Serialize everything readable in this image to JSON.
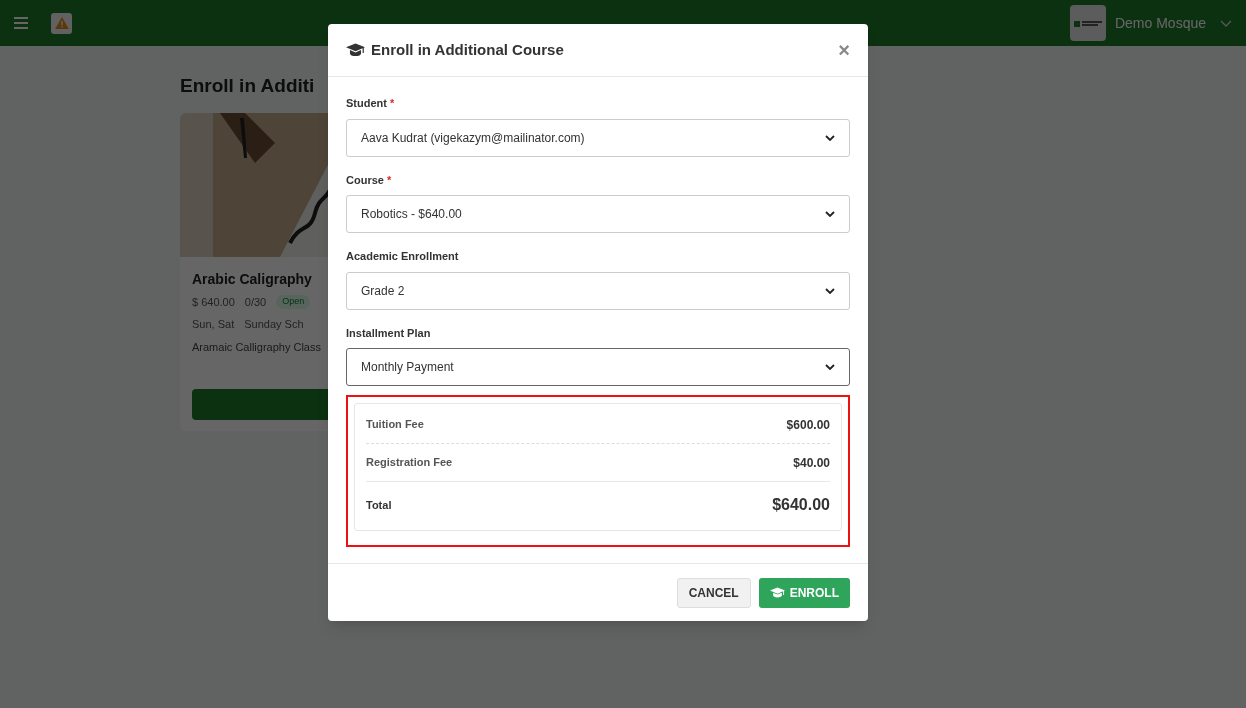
{
  "header": {
    "org_name": "Demo Mosque"
  },
  "page": {
    "title": "Enroll in Additi",
    "card": {
      "kind": "picture",
      "name": "Arabic Caligraphy",
      "price": "$ 640.00",
      "seats": "0/30",
      "status": "Open",
      "days": "Sun, Sat",
      "location": "Sunday Sch",
      "description": "Aramaic Calligraphy Class"
    }
  },
  "modal": {
    "title": "Enroll in Additional Course",
    "close": "×",
    "fields": [
      {
        "label": "Student",
        "required_mark": "*",
        "value": "Aava Kudrat (vigekazym@mailinator.com)",
        "focused": false
      },
      {
        "label": "Course",
        "required_mark": "*",
        "value": "Robotics - $640.00",
        "focused": false
      },
      {
        "label": "Academic Enrollment",
        "value": "Grade 2",
        "focused": false
      },
      {
        "label": "Installment Plan",
        "value": "Monthly Payment",
        "focused": true
      }
    ],
    "fees": [
      {
        "label": "Tuition Fee",
        "amount": "$600.00",
        "kind": "line"
      },
      {
        "label": "Registration Fee",
        "amount": "$40.00",
        "kind": "line"
      },
      {
        "label": "Total",
        "amount": "$640.00",
        "kind": "total"
      }
    ],
    "highlighted": true,
    "buttons": [
      {
        "label": "CANCEL",
        "kind": "secondary"
      },
      {
        "label": "ENROLL",
        "kind": "primary"
      }
    ]
  }
}
